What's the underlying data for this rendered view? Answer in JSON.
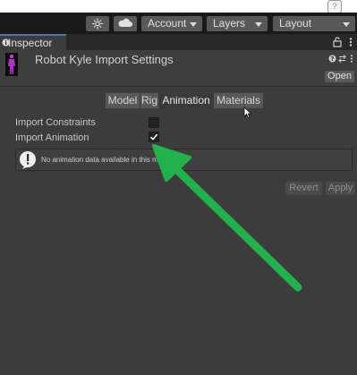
{
  "toolbar": {
    "help_label": "?",
    "account_label": "Account",
    "layers_label": "Layers",
    "layout_label": "Layout"
  },
  "tab": {
    "label": "Inspector"
  },
  "header": {
    "title": "Robot Kyle Import Settings",
    "open_label": "Open"
  },
  "segments": [
    "Model",
    "Rig",
    "Animation",
    "Materials"
  ],
  "active_segment": "Animation",
  "fields": {
    "import_constraints": {
      "label": "Import Constraints",
      "checked": false
    },
    "import_animation": {
      "label": "Import Animation",
      "checked": true
    }
  },
  "warning": {
    "message": "No animation data available in this model."
  },
  "footer": {
    "revert_label": "Revert",
    "apply_label": "Apply"
  },
  "annotation": {
    "arrow_color": "#22b14c"
  },
  "colors": {
    "panel_bg": "#3c3c3c",
    "toolbar_bg": "#191919",
    "tab_accent": "#3a79bb",
    "button_bg": "#585858"
  }
}
